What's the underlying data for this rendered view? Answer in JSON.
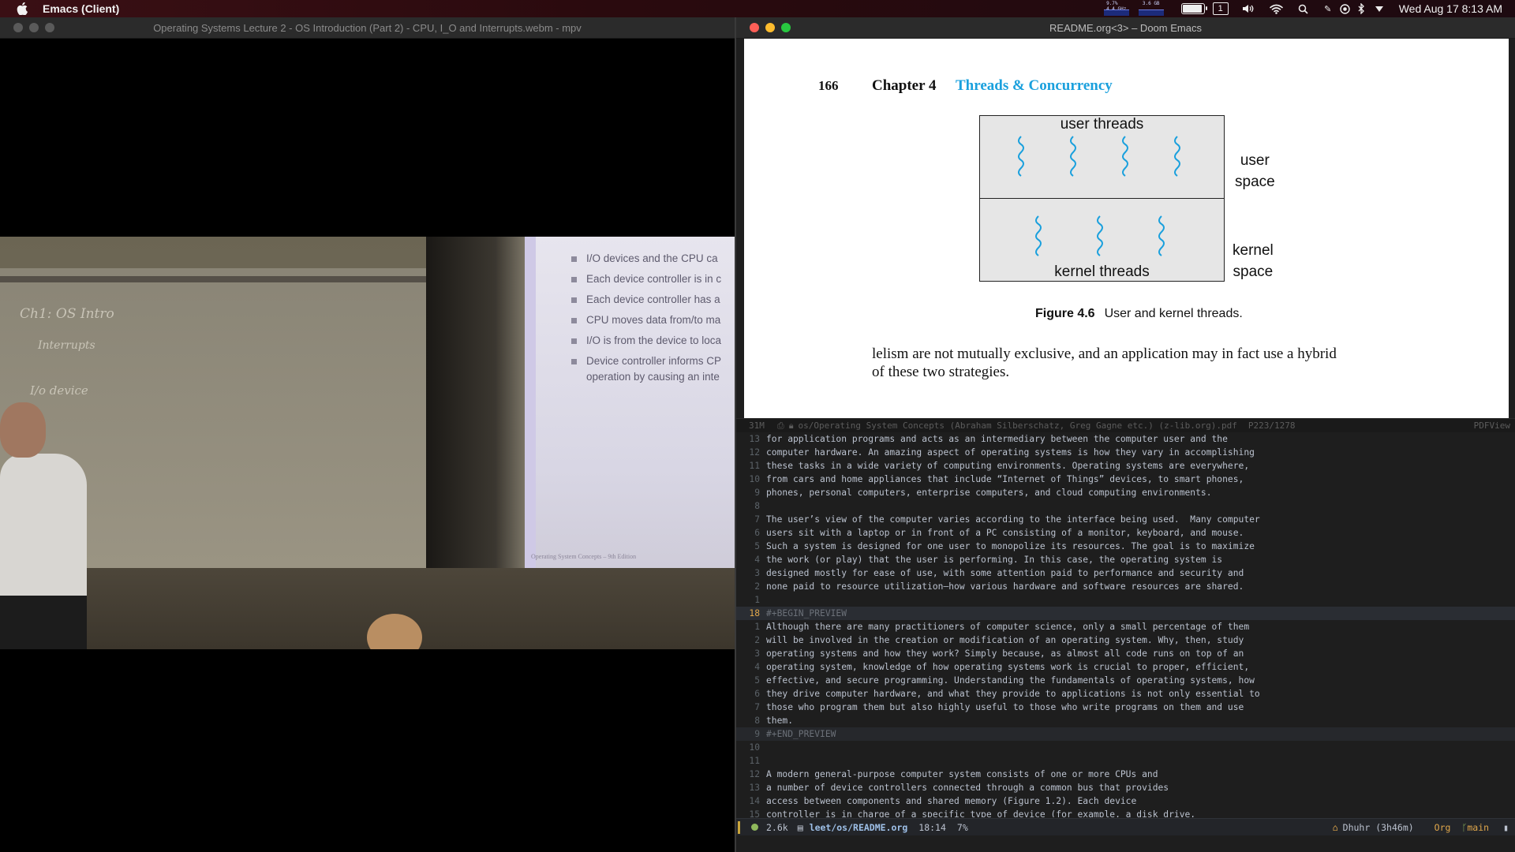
{
  "menubar": {
    "app_name": "Emacs (Client)",
    "clock": "Wed Aug 17  8:13 AM",
    "workspace": "1",
    "battery_level": 0.95,
    "stats": [
      {
        "label": "9.7%\n4.4 GHz"
      },
      {
        "label": "3.6 GB"
      }
    ]
  },
  "mpv": {
    "title": "Operating Systems Lecture 2 - OS Introduction (Part 2) - CPU, I_O and Interrupts.webm - mpv",
    "slide_bullets": [
      "I/O devices and the CPU ca",
      "Each device controller is in c",
      "Each device controller has a",
      "CPU moves data from/to ma",
      "I/O is from the device to loca",
      "Device controller informs CP",
      "operation by causing an inte"
    ],
    "slide_footer": "Operating System Concepts – 9th Edition",
    "chalk": [
      "Ch1:  OS  Intro",
      "Interrupts",
      "I/o  device"
    ]
  },
  "emacs": {
    "title": "README.org<3> – Doom Emacs",
    "pdf": {
      "page_number": "166",
      "chapter_label": "Chapter 4",
      "chapter_title": "Threads & Concurrency",
      "box_top_label": "user threads",
      "box_bottom_label": "kernel threads",
      "side_top": [
        "user",
        "space"
      ],
      "side_bottom": [
        "kernel",
        "space"
      ],
      "figure_num": "Figure 4.6",
      "figure_caption": "User and kernel threads.",
      "para_line1": "lelism are not mutually exclusive, and an application may in fact use a hybrid",
      "para_line2": "of these two strategies."
    },
    "pdf_modeline": {
      "size": "31M",
      "path": "os/Operating System Concepts (Abraham Silberschatz, Greg Gagne etc.) (z-lib.org).pdf",
      "page": "P223/1278",
      "mode": "PDFView"
    },
    "lines": [
      {
        "n": "13",
        "t": "for application programs and acts as an intermediary between the computer user and the"
      },
      {
        "n": "12",
        "t": "computer hardware. An amazing aspect of operating systems is how they vary in accomplishing"
      },
      {
        "n": "11",
        "t": "these tasks in a wide variety of computing environments. Operating systems are everywhere,"
      },
      {
        "n": "10",
        "t": "from cars and home appliances that include “Internet of Things” devices, to smart phones,"
      },
      {
        "n": "9",
        "t": "phones, personal computers, enterprise computers, and cloud computing environments."
      },
      {
        "n": "8",
        "t": ""
      },
      {
        "n": "7",
        "t": "The user’s view of the computer varies according to the interface being used.  Many computer"
      },
      {
        "n": "6",
        "t": "users sit with a laptop or in front of a PC consisting of a monitor, keyboard, and mouse."
      },
      {
        "n": "5",
        "t": "Such a system is designed for one user to monopolize its resources. The goal is to maximize"
      },
      {
        "n": "4",
        "t": "the work (or play) that the user is performing. In this case, the operating system is"
      },
      {
        "n": "3",
        "t": "designed mostly for ease of use, with some attention paid to performance and security and"
      },
      {
        "n": "2",
        "t": "none paid to resource utilization—how various hardware and software resources are shared."
      },
      {
        "n": "1",
        "t": ""
      },
      {
        "n": "18",
        "t": "#+BEGIN_PREVIEW",
        "cur": true
      },
      {
        "n": "1",
        "t": "Although there are many practitioners of computer science, only a small percentage of them"
      },
      {
        "n": "2",
        "t": "will be involved in the creation or modification of an operating system. Why, then, study"
      },
      {
        "n": "3",
        "t": "operating systems and how they work? Simply because, as almost all code runs on top of an"
      },
      {
        "n": "4",
        "t": "operating system, knowledge of how operating systems work is crucial to proper, efficient,"
      },
      {
        "n": "5",
        "t": "effective, and secure programming. Understanding the fundamentals of operating systems, how"
      },
      {
        "n": "6",
        "t": "they drive computer hardware, and what they provide to applications is not only essential to"
      },
      {
        "n": "7",
        "t": "those who program them but also highly useful to those who write programs on them and use"
      },
      {
        "n": "8",
        "t": "them."
      },
      {
        "n": "9",
        "t": "#+END_PREVIEW",
        "block": true
      },
      {
        "n": "10",
        "t": ""
      },
      {
        "n": "11",
        "t": ""
      },
      {
        "n": "12",
        "t": "A modern general-purpose computer system consists of one or more CPUs and"
      },
      {
        "n": "13",
        "t": "a number of device controllers connected through a common bus that provides"
      },
      {
        "n": "14",
        "t": "access between components and shared memory (Figure 1.2). Each device"
      },
      {
        "n": "15",
        "t": "controller is in charge of a specific type of device (for example, a disk drive,"
      }
    ],
    "modeline": {
      "size": "2.6k",
      "file": "leet/os/README.org",
      "position": "18:14",
      "percent": "7%",
      "prayer": "Dhuhr (3h46m)",
      "major_mode": "Org",
      "branch": "main"
    }
  }
}
